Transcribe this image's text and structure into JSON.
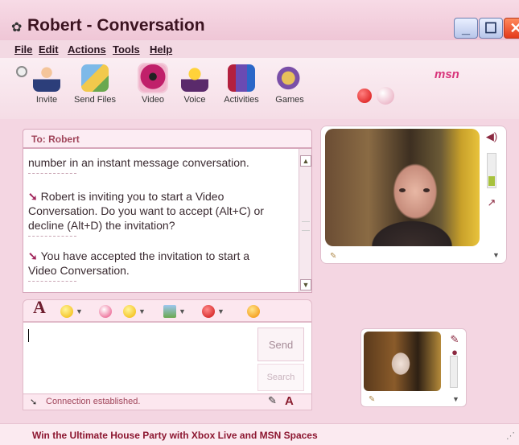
{
  "window": {
    "title": "Robert - Conversation",
    "min_label": "_",
    "max_label": "☐",
    "close_label": "✕"
  },
  "menubar": {
    "items": [
      "File",
      "Edit",
      "Actions",
      "Tools",
      "Help"
    ]
  },
  "toolbar": {
    "buttons": [
      {
        "label": "Invite",
        "icon": "invite-people-icon"
      },
      {
        "label": "Send Files",
        "icon": "send-files-icon"
      },
      {
        "label": "Video",
        "icon": "webcam-icon"
      },
      {
        "label": "Voice",
        "icon": "microphone-headset-icon"
      },
      {
        "label": "Activities",
        "icon": "activities-icon"
      },
      {
        "label": "Games",
        "icon": "games-icon"
      }
    ],
    "brand": "msn"
  },
  "conversation": {
    "to_label": "To: Robert",
    "lines": [
      "number in an instant message conversation.",
      "Robert is inviting you to start a Video",
      "Conversation. Do you want to accept (Alt+C) or",
      "decline (Alt+D) the invitation?",
      "You have accepted the invitation to start a",
      "Video Conversation."
    ]
  },
  "compose": {
    "send_label": "Send",
    "search_label": "Search"
  },
  "status": {
    "text": "Connection established."
  },
  "ad": {
    "text": "Win the Ultimate House Party with Xbox Live and MSN Spaces"
  },
  "colors": {
    "accent": "#d8347a",
    "title": "#3b1320",
    "frame": "#f4d6e2"
  }
}
